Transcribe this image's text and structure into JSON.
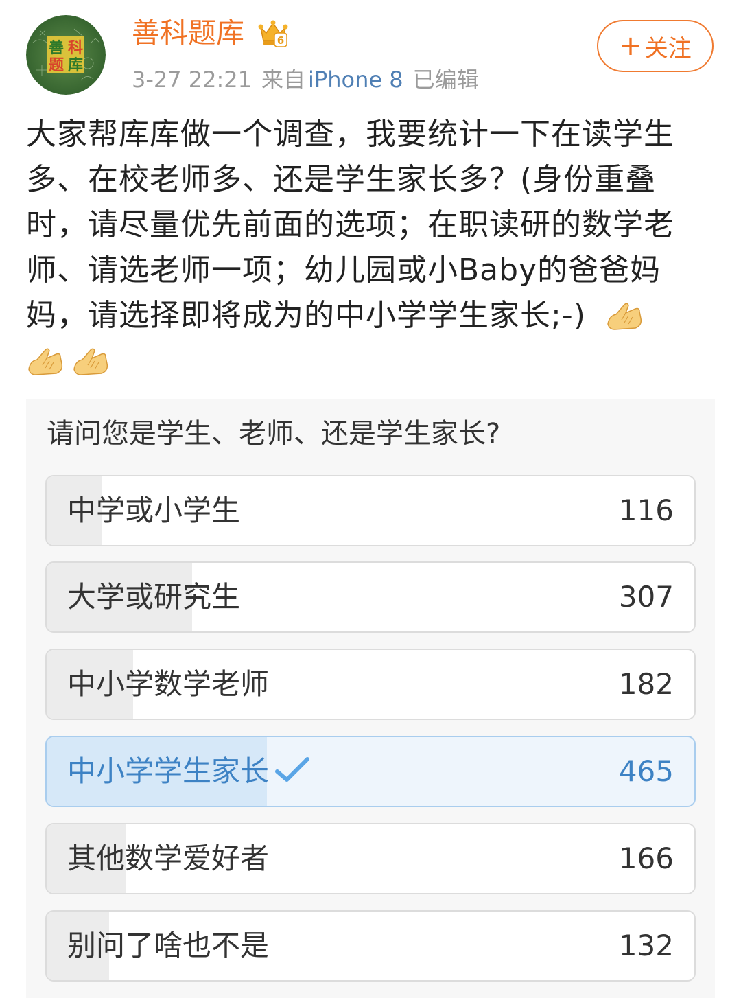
{
  "user": {
    "name": "善科题库",
    "avatar_text": [
      "善",
      "科",
      "题",
      "库"
    ],
    "badge_icon": "vip-crown-icon",
    "badge_level": "6",
    "name_color": "#f07224"
  },
  "meta": {
    "time": "3-27 22:21",
    "source_prefix": "来自",
    "source_device": "iPhone 8",
    "edited": "已编辑"
  },
  "follow_button": {
    "plus": "+",
    "label": "关注",
    "color": "#f07224"
  },
  "post": {
    "text": "大家帮库库做一个调查，我要统计一下在读学生多、在校老师多、还是学生家长多？(身份重叠时，请尽量优先前面的选项；在职读研的数学老师、请选老师一项；幼儿园或小Baby的爸爸妈妈，请选择即将成为的中小学学生家长;-)",
    "emoji_icon": "pleading-hands-emoji",
    "emoji_count": 3
  },
  "poll": {
    "question": "请问您是学生、老师、还是学生家长?",
    "selected_color": "#3d82c4",
    "options": [
      {
        "label": "中学或小学生",
        "count": "116",
        "value": 116,
        "selected": false
      },
      {
        "label": "大学或研究生",
        "count": "307",
        "value": 307,
        "selected": false
      },
      {
        "label": "中小学数学老师",
        "count": "182",
        "value": 182,
        "selected": false
      },
      {
        "label": "中小学学生家长",
        "count": "465",
        "value": 465,
        "selected": true
      },
      {
        "label": "其他数学爱好者",
        "count": "166",
        "value": 166,
        "selected": false
      },
      {
        "label": "别问了啥也不是",
        "count": "132",
        "value": 132,
        "selected": false
      }
    ]
  }
}
